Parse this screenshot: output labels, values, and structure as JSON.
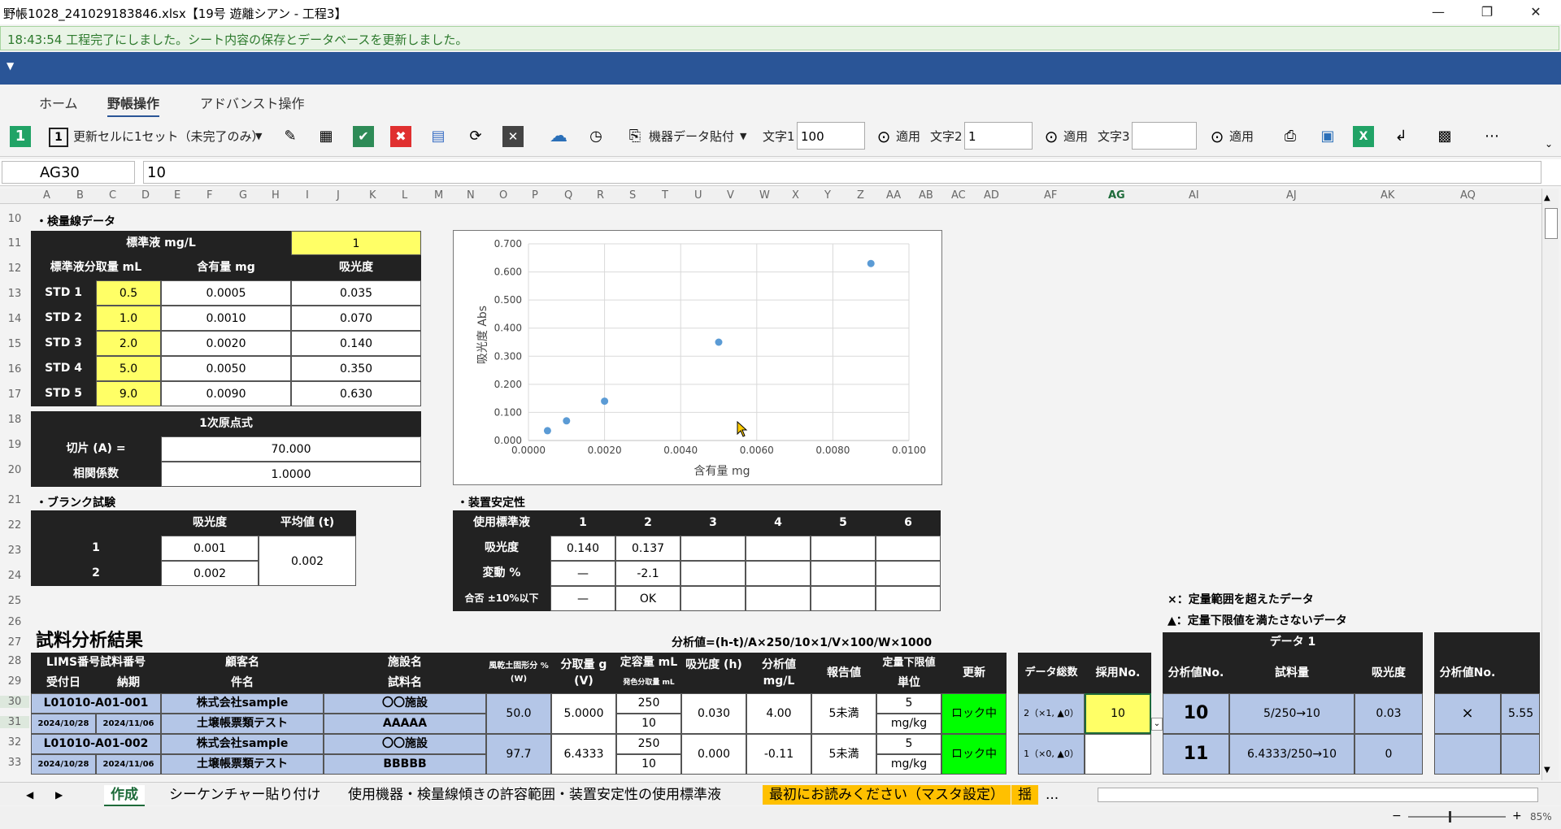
{
  "window": {
    "title": "野帳1028_241029183846.xlsx【19号 遊離シアン - 工程3】",
    "minimize": "—",
    "restore": "❐",
    "close": "✕"
  },
  "notice": "18:43:54 工程完了にしました。シート内容の保存とデータベースを更新しました。",
  "ribbon_tabs": [
    "ホーム",
    "野帳操作",
    "アドバンスト操作"
  ],
  "toolbar": {
    "update_label": "更新セルに1セット（未完了のみ）",
    "paste_label": "機器データ貼付",
    "text1_label": "文字1",
    "text1_value": "100",
    "text2_label": "文字2",
    "text2_value": "1",
    "text3_label": "文字3",
    "text3_value": "",
    "apply_label": "適用"
  },
  "formula": {
    "name_box": "AG30",
    "value": "10"
  },
  "columns": [
    "A",
    "B",
    "C",
    "D",
    "E",
    "F",
    "G",
    "H",
    "I",
    "J",
    "K",
    "L",
    "M",
    "N",
    "O",
    "P",
    "Q",
    "R",
    "S",
    "T",
    "U",
    "V",
    "W",
    "X",
    "Y",
    "Z",
    "AA",
    "AB",
    "AC",
    "AD",
    "AF",
    "AG",
    "AI",
    "AJ",
    "AK",
    "AQ"
  ],
  "rows": [
    "10",
    "11",
    "12",
    "13",
    "14",
    "15",
    "16",
    "17",
    "18",
    "19",
    "20",
    "21",
    "22",
    "23",
    "24",
    "25",
    "26",
    "27",
    "28",
    "29",
    "30",
    "31",
    "32",
    "33"
  ],
  "calib": {
    "section": "・検量線データ",
    "std_label": "標準液 mg/L",
    "std_value": "1",
    "h_vol": "標準液分取量 mL",
    "h_content": "含有量 mg",
    "h_abs": "吸光度",
    "rows": [
      {
        "name": "STD 1",
        "vol": "0.5",
        "content": "0.0005",
        "abs": "0.035"
      },
      {
        "name": "STD 2",
        "vol": "1.0",
        "content": "0.0010",
        "abs": "0.070"
      },
      {
        "name": "STD 3",
        "vol": "2.0",
        "content": "0.0020",
        "abs": "0.140"
      },
      {
        "name": "STD 4",
        "vol": "5.0",
        "content": "0.0050",
        "abs": "0.350"
      },
      {
        "name": "STD 5",
        "vol": "9.0",
        "content": "0.0090",
        "abs": "0.630"
      }
    ],
    "eq_label": "1次原点式",
    "intercept_label": "切片 (A) =",
    "intercept_value": "70.000",
    "corr_label": "相関係数",
    "corr_value": "1.0000"
  },
  "chart_data": {
    "type": "scatter",
    "x": [
      0.0005,
      0.001,
      0.002,
      0.005,
      0.009
    ],
    "y": [
      0.035,
      0.07,
      0.14,
      0.35,
      0.63
    ],
    "xlabel": "含有量 mg",
    "ylabel": "吸光度 Abs",
    "xlim": [
      0,
      0.01
    ],
    "ylim": [
      0,
      0.7
    ],
    "xticks": [
      "0.0000",
      "0.0020",
      "0.0040",
      "0.0060",
      "0.0080",
      "0.0100"
    ],
    "yticks": [
      "0.000",
      "0.100",
      "0.200",
      "0.300",
      "0.400",
      "0.500",
      "0.600",
      "0.700"
    ],
    "grid": true,
    "color": "#5b9bd5"
  },
  "blank": {
    "section": "・ブランク試験",
    "h_abs": "吸光度",
    "h_avg": "平均値 (t)",
    "rows": [
      {
        "n": "1",
        "abs": "0.001"
      },
      {
        "n": "2",
        "abs": "0.002"
      }
    ],
    "avg": "0.002"
  },
  "stability": {
    "section": "・装置安定性",
    "h_std": "使用標準液",
    "cols": [
      "1",
      "2",
      "3",
      "4",
      "5",
      "6"
    ],
    "r_abs": "吸光度",
    "abs": [
      "0.140",
      "0.137",
      "",
      "",
      "",
      ""
    ],
    "r_var": "変動 %",
    "var": [
      "—",
      "-2.1",
      "",
      "",
      "",
      ""
    ],
    "r_pass": "合否 ±10%以下",
    "pass": [
      "—",
      "OK",
      "",
      "",
      "",
      ""
    ]
  },
  "legend_notes": [
    "×：定量範囲を超えたデータ",
    "▲：定量下限値を満たさないデータ"
  ],
  "results": {
    "title": "試料分析結果",
    "formula": "分析値=(h-t)/A×250/10×1/V×100/W×1000",
    "h": {
      "lims": "LIMS番号試料番号",
      "recv": "受付日",
      "due": "納期",
      "client": "顧客名",
      "subject": "件名",
      "facility": "施設名",
      "sample": "試料名",
      "moist": "風乾土固形分 % (W)",
      "take": "分取量 g (V)",
      "vol": "定容量 mL",
      "vol2": "発色分取量 mL",
      "abs": "吸光度 (h)",
      "anal": "分析値 mg/L",
      "report": "報告値",
      "limit": "定量下限値",
      "unit": "単位",
      "update": "更新",
      "total": "データ総数",
      "adopt": "採用No.",
      "data1": "データ 1",
      "d_no": "分析値No.",
      "d_amt": "試料量",
      "d_abs": "吸光度",
      "d2_no": "分析値No."
    },
    "rows": [
      {
        "lims": "L01010-A01-001",
        "recv": "2024/10/28",
        "due": "2024/11/06",
        "client": "株式会社sample",
        "subject": "土壌帳票類テスト",
        "facility": "〇〇施設",
        "sample": "AAAAA",
        "moist": "50.0",
        "take": "5.0000",
        "vol": "250",
        "vol2": "10",
        "abs": "0.030",
        "anal": "4.00",
        "report": "5未満",
        "limit": "5",
        "unit": "mg/kg",
        "update": "ロック中",
        "total": "2（×1, ▲0）",
        "adopt": "10",
        "d_no": "10",
        "d_amt": "5/250→10",
        "d_abs": "0.03",
        "d2_no": "×",
        "d2_val": "5.55"
      },
      {
        "lims": "L01010-A01-002",
        "recv": "2024/10/28",
        "due": "2024/11/06",
        "client": "株式会社sample",
        "subject": "土壌帳票類テスト",
        "facility": "〇〇施設",
        "sample": "BBBBB",
        "moist": "97.7",
        "take": "6.4333",
        "vol": "250",
        "vol2": "10",
        "abs": "0.000",
        "anal": "-0.11",
        "report": "5未満",
        "limit": "5",
        "unit": "mg/kg",
        "update": "ロック中",
        "total": "1（×0, ▲0）",
        "adopt": "",
        "d_no": "11",
        "d_amt": "6.4333/250→10",
        "d_abs": "0",
        "d2_no": "",
        "d2_val": ""
      }
    ]
  },
  "sheet_tabs": [
    "作成",
    "シーケンチャー貼り付け",
    "使用機器・検量線傾きの許容範囲・装置安定性の使用標準液",
    "最初にお読みください（マスタ設定）",
    "揺",
    "..."
  ],
  "zoom": "85%"
}
